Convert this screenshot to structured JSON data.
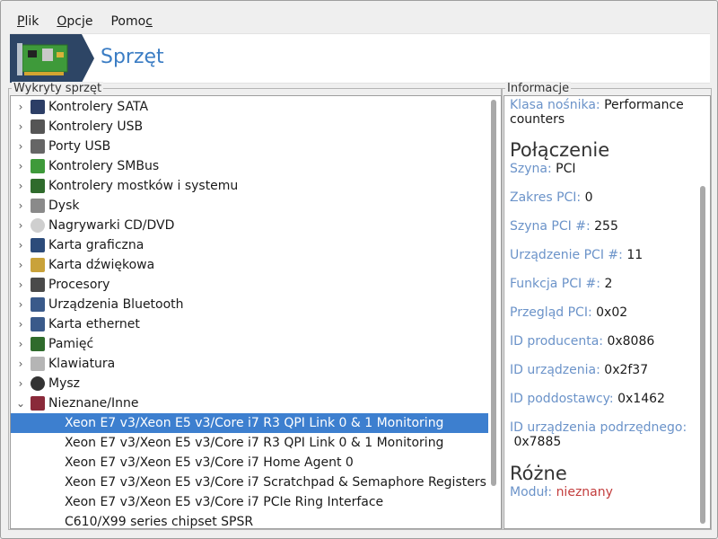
{
  "menu": [
    {
      "label": "Plik",
      "u": "P",
      "rest": "lik"
    },
    {
      "label": "Opcje",
      "u": "O",
      "rest": "pcje"
    },
    {
      "label": "Pomoc",
      "pre": "Pomo",
      "u": "c"
    }
  ],
  "banner": {
    "title": "Sprzęt"
  },
  "left_title": "Wykryty sprzęt",
  "right_title": "Informacje",
  "categories": [
    {
      "label": "Kontrolery SATA",
      "icon": "sata-controller-icon"
    },
    {
      "label": "Kontrolery USB",
      "icon": "usb-icon"
    },
    {
      "label": "Porty USB",
      "icon": "usb-port-icon"
    },
    {
      "label": "Kontrolery SMBus",
      "icon": "smbus-icon"
    },
    {
      "label": "Kontrolery mostków i systemu",
      "icon": "bridge-icon"
    },
    {
      "label": "Dysk",
      "icon": "disk-icon"
    },
    {
      "label": "Nagrywarki CD/DVD",
      "icon": "cd-icon"
    },
    {
      "label": "Karta graficzna",
      "icon": "graphics-card-icon"
    },
    {
      "label": "Karta dźwiękowa",
      "icon": "sound-card-icon"
    },
    {
      "label": "Procesory",
      "icon": "cpu-icon"
    },
    {
      "label": "Urządzenia Bluetooth",
      "icon": "bluetooth-icon"
    },
    {
      "label": "Karta ethernet",
      "icon": "ethernet-icon"
    },
    {
      "label": "Pamięć",
      "icon": "memory-icon"
    },
    {
      "label": "Klawiatura",
      "icon": "keyboard-icon"
    },
    {
      "label": "Mysz",
      "icon": "mouse-icon"
    },
    {
      "label": "Nieznane/Inne",
      "icon": "unknown-device-icon",
      "expanded": true
    }
  ],
  "children": [
    "Xeon E7 v3/Xeon E5 v3/Core i7 R3 QPI Link 0 & 1 Monitoring",
    "Xeon E7 v3/Xeon E5 v3/Core i7 R3 QPI Link 0 & 1 Monitoring",
    "Xeon E7 v3/Xeon E5 v3/Core i7 Home Agent 0",
    "Xeon E7 v3/Xeon E5 v3/Core i7 Scratchpad & Semaphore Registers",
    "Xeon E7 v3/Xeon E5 v3/Core i7 PCIe Ring Interface",
    "C610/X99 series chipset SPSR"
  ],
  "info": {
    "media_class": {
      "key": "Klasa nośnika:",
      "value1": "Performance",
      "value2": "counters"
    },
    "section_connection": "Połączenie",
    "bus": {
      "key": "Szyna:",
      "value": "PCI"
    },
    "pci_domain": {
      "key": "Zakres PCI:",
      "value": "0"
    },
    "pci_bus": {
      "key": "Szyna PCI #:",
      "value": "255"
    },
    "pci_device": {
      "key": "Urządzenie PCI #:",
      "value": "11"
    },
    "pci_function": {
      "key": "Funkcja PCI #:",
      "value": "2"
    },
    "pci_revision": {
      "key": "Przegląd PCI:",
      "value": "0x02"
    },
    "vendor_id": {
      "key": "ID producenta:",
      "value": "0x8086"
    },
    "device_id": {
      "key": "ID urządzenia:",
      "value": "0x2f37"
    },
    "subvendor_id": {
      "key": "ID poddostawcy:",
      "value": "0x1462"
    },
    "subdevice_id": {
      "key": "ID urządzenia podrzędnego:",
      "value": "0x7885"
    },
    "section_misc": "Różne",
    "module": {
      "key": "Moduł:",
      "value": "nieznany"
    }
  }
}
